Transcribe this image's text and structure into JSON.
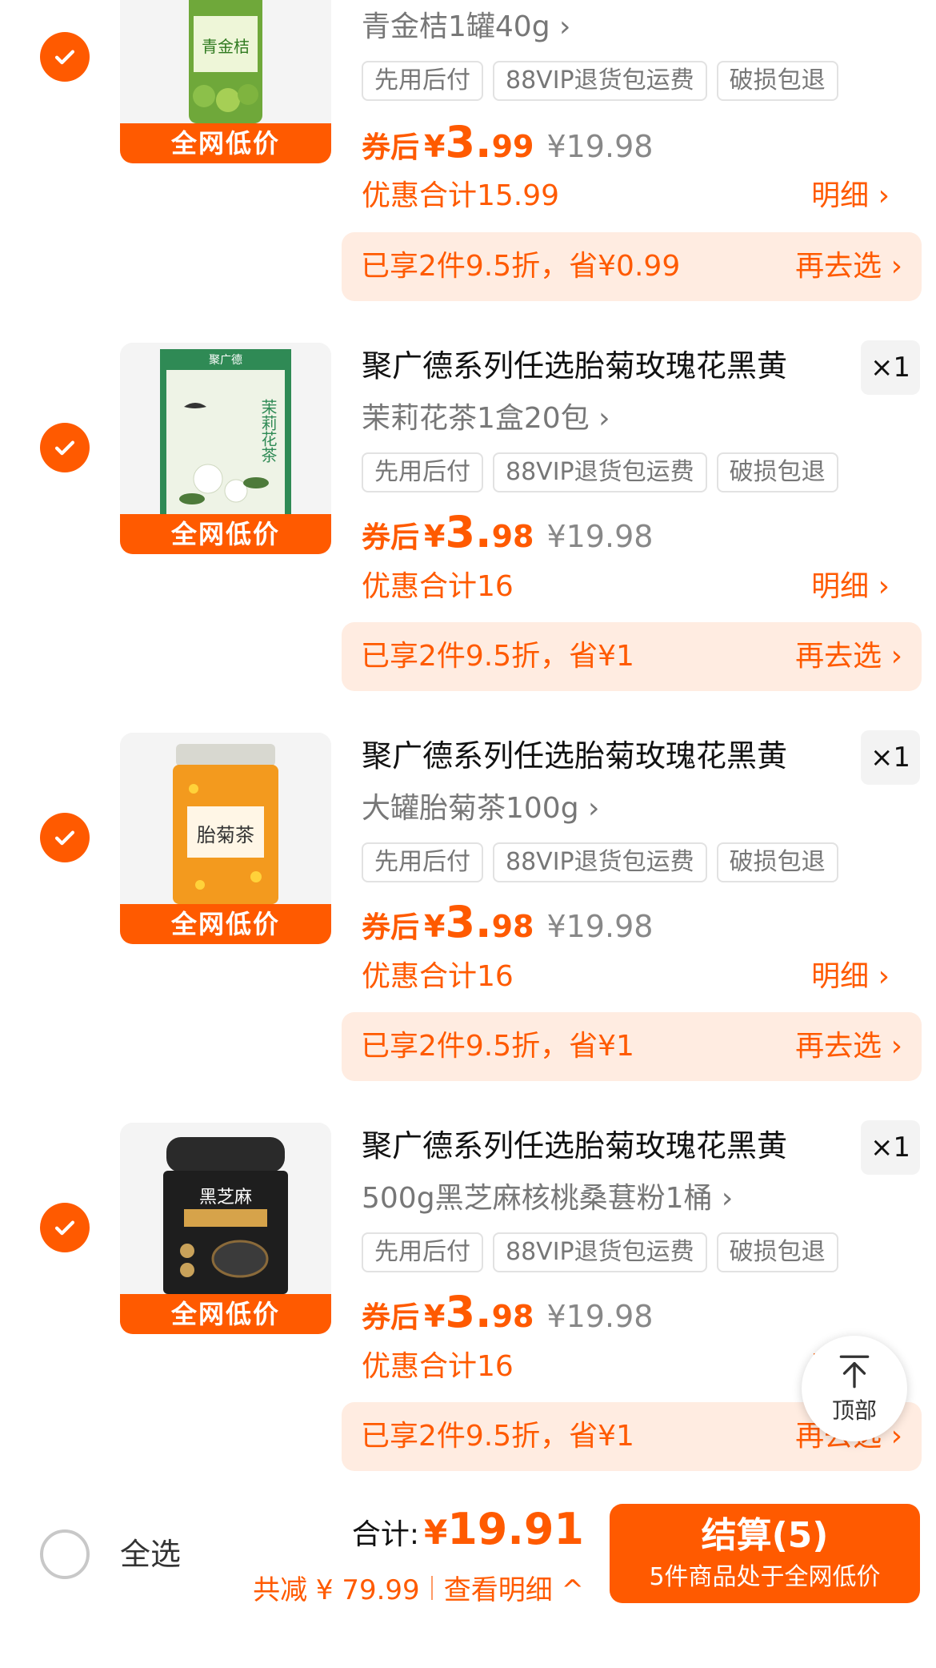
{
  "common": {
    "lowest_badge": "全网低价",
    "tags": [
      "先用后付",
      "88VIP退货包运费",
      "破损包退"
    ],
    "coupon_label": "券后",
    "currency": "¥",
    "detail_label": "明细 ›",
    "again_label": "再去选 ›",
    "title": "聚广德系列任选胎菊玫瑰花黑黄",
    "qty": "×1"
  },
  "items": [
    {
      "spec": "青金桔1罐40g ›",
      "price_int": "3.",
      "price_dec": "99",
      "original": "¥19.98",
      "discount_total": "优惠合计15.99",
      "promo": "已享2件9.5折，省¥0.99",
      "image": "green-kumquat-jar"
    },
    {
      "spec": "茉莉花茶1盒20包 ›",
      "price_int": "3.",
      "price_dec": "98",
      "original": "¥19.98",
      "discount_total": "优惠合计16",
      "promo": "已享2件9.5折，省¥1",
      "image": "jasmine-tea-box"
    },
    {
      "spec": "大罐胎菊茶100g ›",
      "price_int": "3.",
      "price_dec": "98",
      "original": "¥19.98",
      "discount_total": "优惠合计16",
      "promo": "已享2件9.5折，省¥1",
      "image": "chrysanthemum-jar"
    },
    {
      "spec": "500g黑芝麻核桃桑葚粉1桶 ›",
      "price_int": "3.",
      "price_dec": "98",
      "original": "¥19.98",
      "discount_total": "优惠合计16",
      "promo": "已享2件9.5折，省¥1",
      "image": "black-sesame-jar"
    }
  ],
  "to_top": "顶部",
  "bottom": {
    "select_all": "全选",
    "total_label": "合计:",
    "total_currency": "¥",
    "total_value": "19.91",
    "saved": "共减 ¥ 79.99",
    "view_detail": "查看明细 ^",
    "checkout_label": "结算(5)",
    "checkout_sub": "5件商品处于全网低价"
  },
  "colors": {
    "accent": "#ff5a00",
    "promo_bg": "#ffece1"
  }
}
